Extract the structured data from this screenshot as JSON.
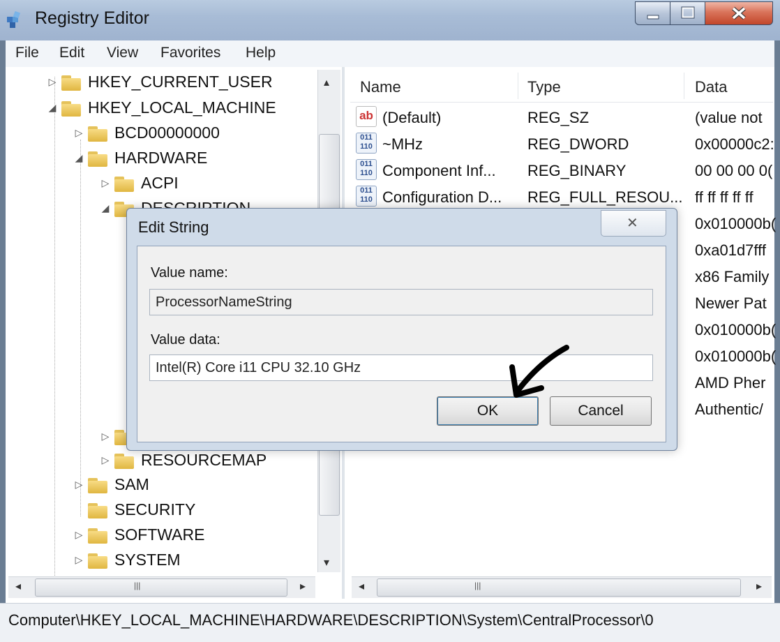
{
  "window": {
    "title": "Registry Editor",
    "menu": [
      "File",
      "Edit",
      "View",
      "Favorites",
      "Help"
    ]
  },
  "tree": {
    "items": [
      {
        "label": "HKEY_CURRENT_USER",
        "expander": "▷"
      },
      {
        "label": "HKEY_LOCAL_MACHINE",
        "expander": "◢"
      },
      {
        "label": "BCD00000000",
        "expander": "▷"
      },
      {
        "label": "HARDWARE",
        "expander": "◢"
      },
      {
        "label": "ACPI",
        "expander": "▷"
      },
      {
        "label": "DESCRIPTION",
        "expander": "◢"
      },
      {
        "label": "RESOURCEMAP",
        "expander": "▷"
      },
      {
        "label": "SAM",
        "expander": "▷"
      },
      {
        "label": "SECURITY",
        "expander": ""
      },
      {
        "label": "SOFTWARE",
        "expander": "▷"
      },
      {
        "label": "SYSTEM",
        "expander": "▷"
      }
    ]
  },
  "values_pane": {
    "columns": [
      "Name",
      "Type",
      "Data"
    ],
    "rows": [
      {
        "icon": "ab",
        "name": "(Default)",
        "type": "REG_SZ",
        "data": "(value not"
      },
      {
        "icon": "bin",
        "name": "~MHz",
        "type": "REG_DWORD",
        "data": "0x00000c2:"
      },
      {
        "icon": "bin",
        "name": "Component Inf...",
        "type": "REG_BINARY",
        "data": "00 00 00 0("
      },
      {
        "icon": "bin",
        "name": "Configuration D...",
        "type": "REG_FULL_RESOU...",
        "data": "ff ff ff ff ff"
      },
      {
        "icon": "",
        "name": "",
        "type": "",
        "data": "0x010000b("
      },
      {
        "icon": "",
        "name": "",
        "type": "",
        "data": "0xa01d7fff"
      },
      {
        "icon": "",
        "name": "",
        "type": "",
        "data": "x86 Family"
      },
      {
        "icon": "",
        "name": "",
        "type": "",
        "data": "Newer Pat"
      },
      {
        "icon": "",
        "name": "",
        "type": "",
        "data": "0x010000b("
      },
      {
        "icon": "",
        "name": "",
        "type": "",
        "data": "0x010000b("
      },
      {
        "icon": "",
        "name": "",
        "type": "",
        "data": "AMD Pher"
      },
      {
        "icon": "",
        "name": "",
        "type": "",
        "data": "Authentic/"
      }
    ]
  },
  "dialog": {
    "title": "Edit String",
    "close_glyph": "✕",
    "value_name_label": "Value name:",
    "value_name": "ProcessorNameString",
    "value_data_label": "Value data:",
    "value_data": "Intel(R) Core  i11 CPU 32.10 GHz",
    "ok_label": "OK",
    "cancel_label": "Cancel"
  },
  "status_bar": {
    "path": "Computer\\HKEY_LOCAL_MACHINE\\HARDWARE\\DESCRIPTION\\System\\CentralProcessor\\0"
  },
  "scrollbar_glyphs": {
    "left": "◂",
    "right": "▸",
    "up": "▴",
    "down": "▾",
    "grip": "|||"
  },
  "colors": {
    "titlebar": "#a8bcd6",
    "close_button": "#c2462a",
    "folder": "#e5c25a"
  }
}
